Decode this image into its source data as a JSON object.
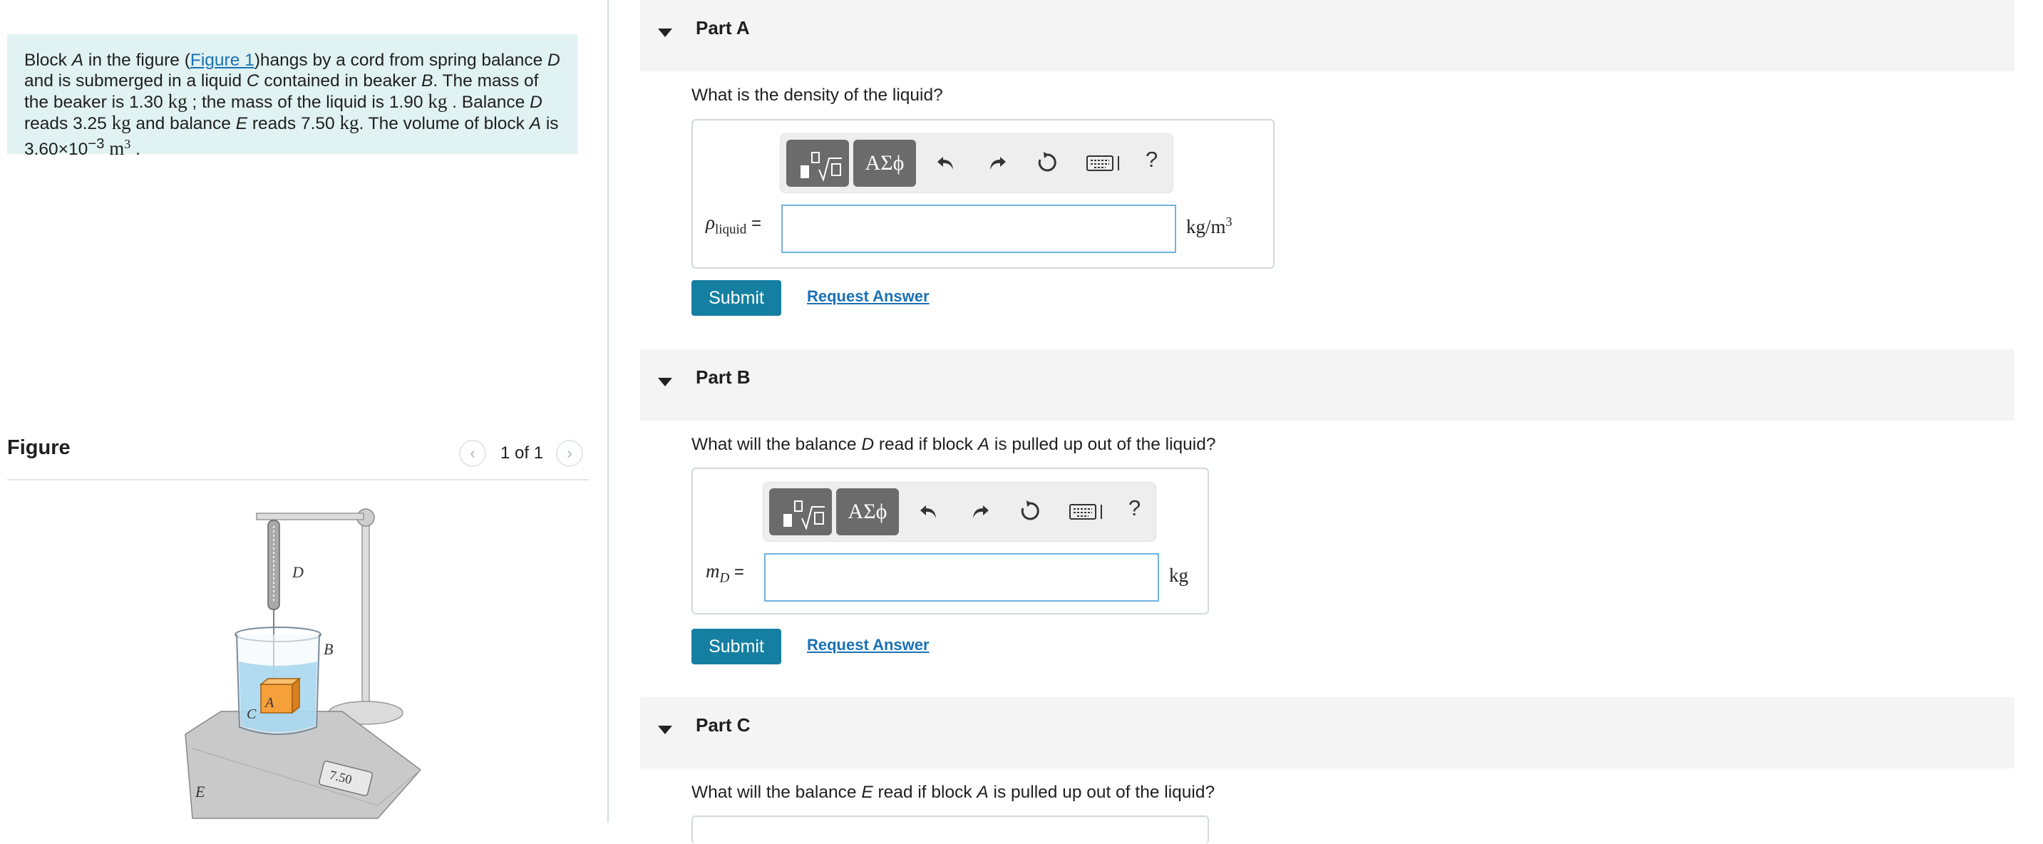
{
  "problem": {
    "t1": "Block ",
    "A": "A",
    "t2": " in the figure (",
    "fig_link": "Figure 1",
    "t3": ")hangs by a cord from spring balance ",
    "D": "D",
    "t4": " and is submerged in a liquid ",
    "C": "C",
    "t5": " contained in beaker ",
    "B": "B",
    "t6": ". The mass of the beaker is 1.30 ",
    "kg1": "kg",
    "t7": " ; the mass of the liquid is 1.90 ",
    "kg2": "kg",
    "t8": " . Balance ",
    "D2": "D",
    "t9": " reads 3.25 ",
    "kg3": "kg",
    "t10": " and balance ",
    "E": "E",
    "t11": " reads 7.50 ",
    "kg4": "kg",
    "t12": ". The volume of block ",
    "A2": "A",
    "t13": " is 3.60×10",
    "exp": "−3",
    "m": " m",
    "m_exp": "3",
    "t14": " ."
  },
  "figure": {
    "title": "Figure",
    "pager": "1 of 1",
    "labels": {
      "D": "D",
      "B": "B",
      "A": "A",
      "C": "C",
      "E": "E",
      "scale": "7.50"
    }
  },
  "toolbar": {
    "greek": "ΑΣϕ",
    "help": "?"
  },
  "parts": [
    {
      "title": "Part A",
      "question": "What is the density of the liquid?",
      "var": "ρ",
      "var_sub": "liquid",
      "eq": " =",
      "unit": "kg/m",
      "unit_exp": "3",
      "submit": "Submit",
      "request": "Request Answer"
    },
    {
      "title": "Part B",
      "q1": "What will the balance ",
      "qD": "D",
      "q2": " read if block ",
      "qA": "A",
      "q3": " is pulled up out of the liquid?",
      "var": "m",
      "var_sub": "D",
      "eq": " =",
      "unit": "kg",
      "submit": "Submit",
      "request": "Request Answer"
    },
    {
      "title": "Part C",
      "q1": "What will the balance ",
      "qE": "E",
      "q2": " read if block ",
      "qA": "A",
      "q3": " is pulled up out of the liquid?"
    }
  ],
  "colors": {
    "accent": "#147fa1",
    "link": "#1b71b5",
    "problem_bg": "#e0f2f1",
    "part_bar": "#f4f4f4"
  }
}
